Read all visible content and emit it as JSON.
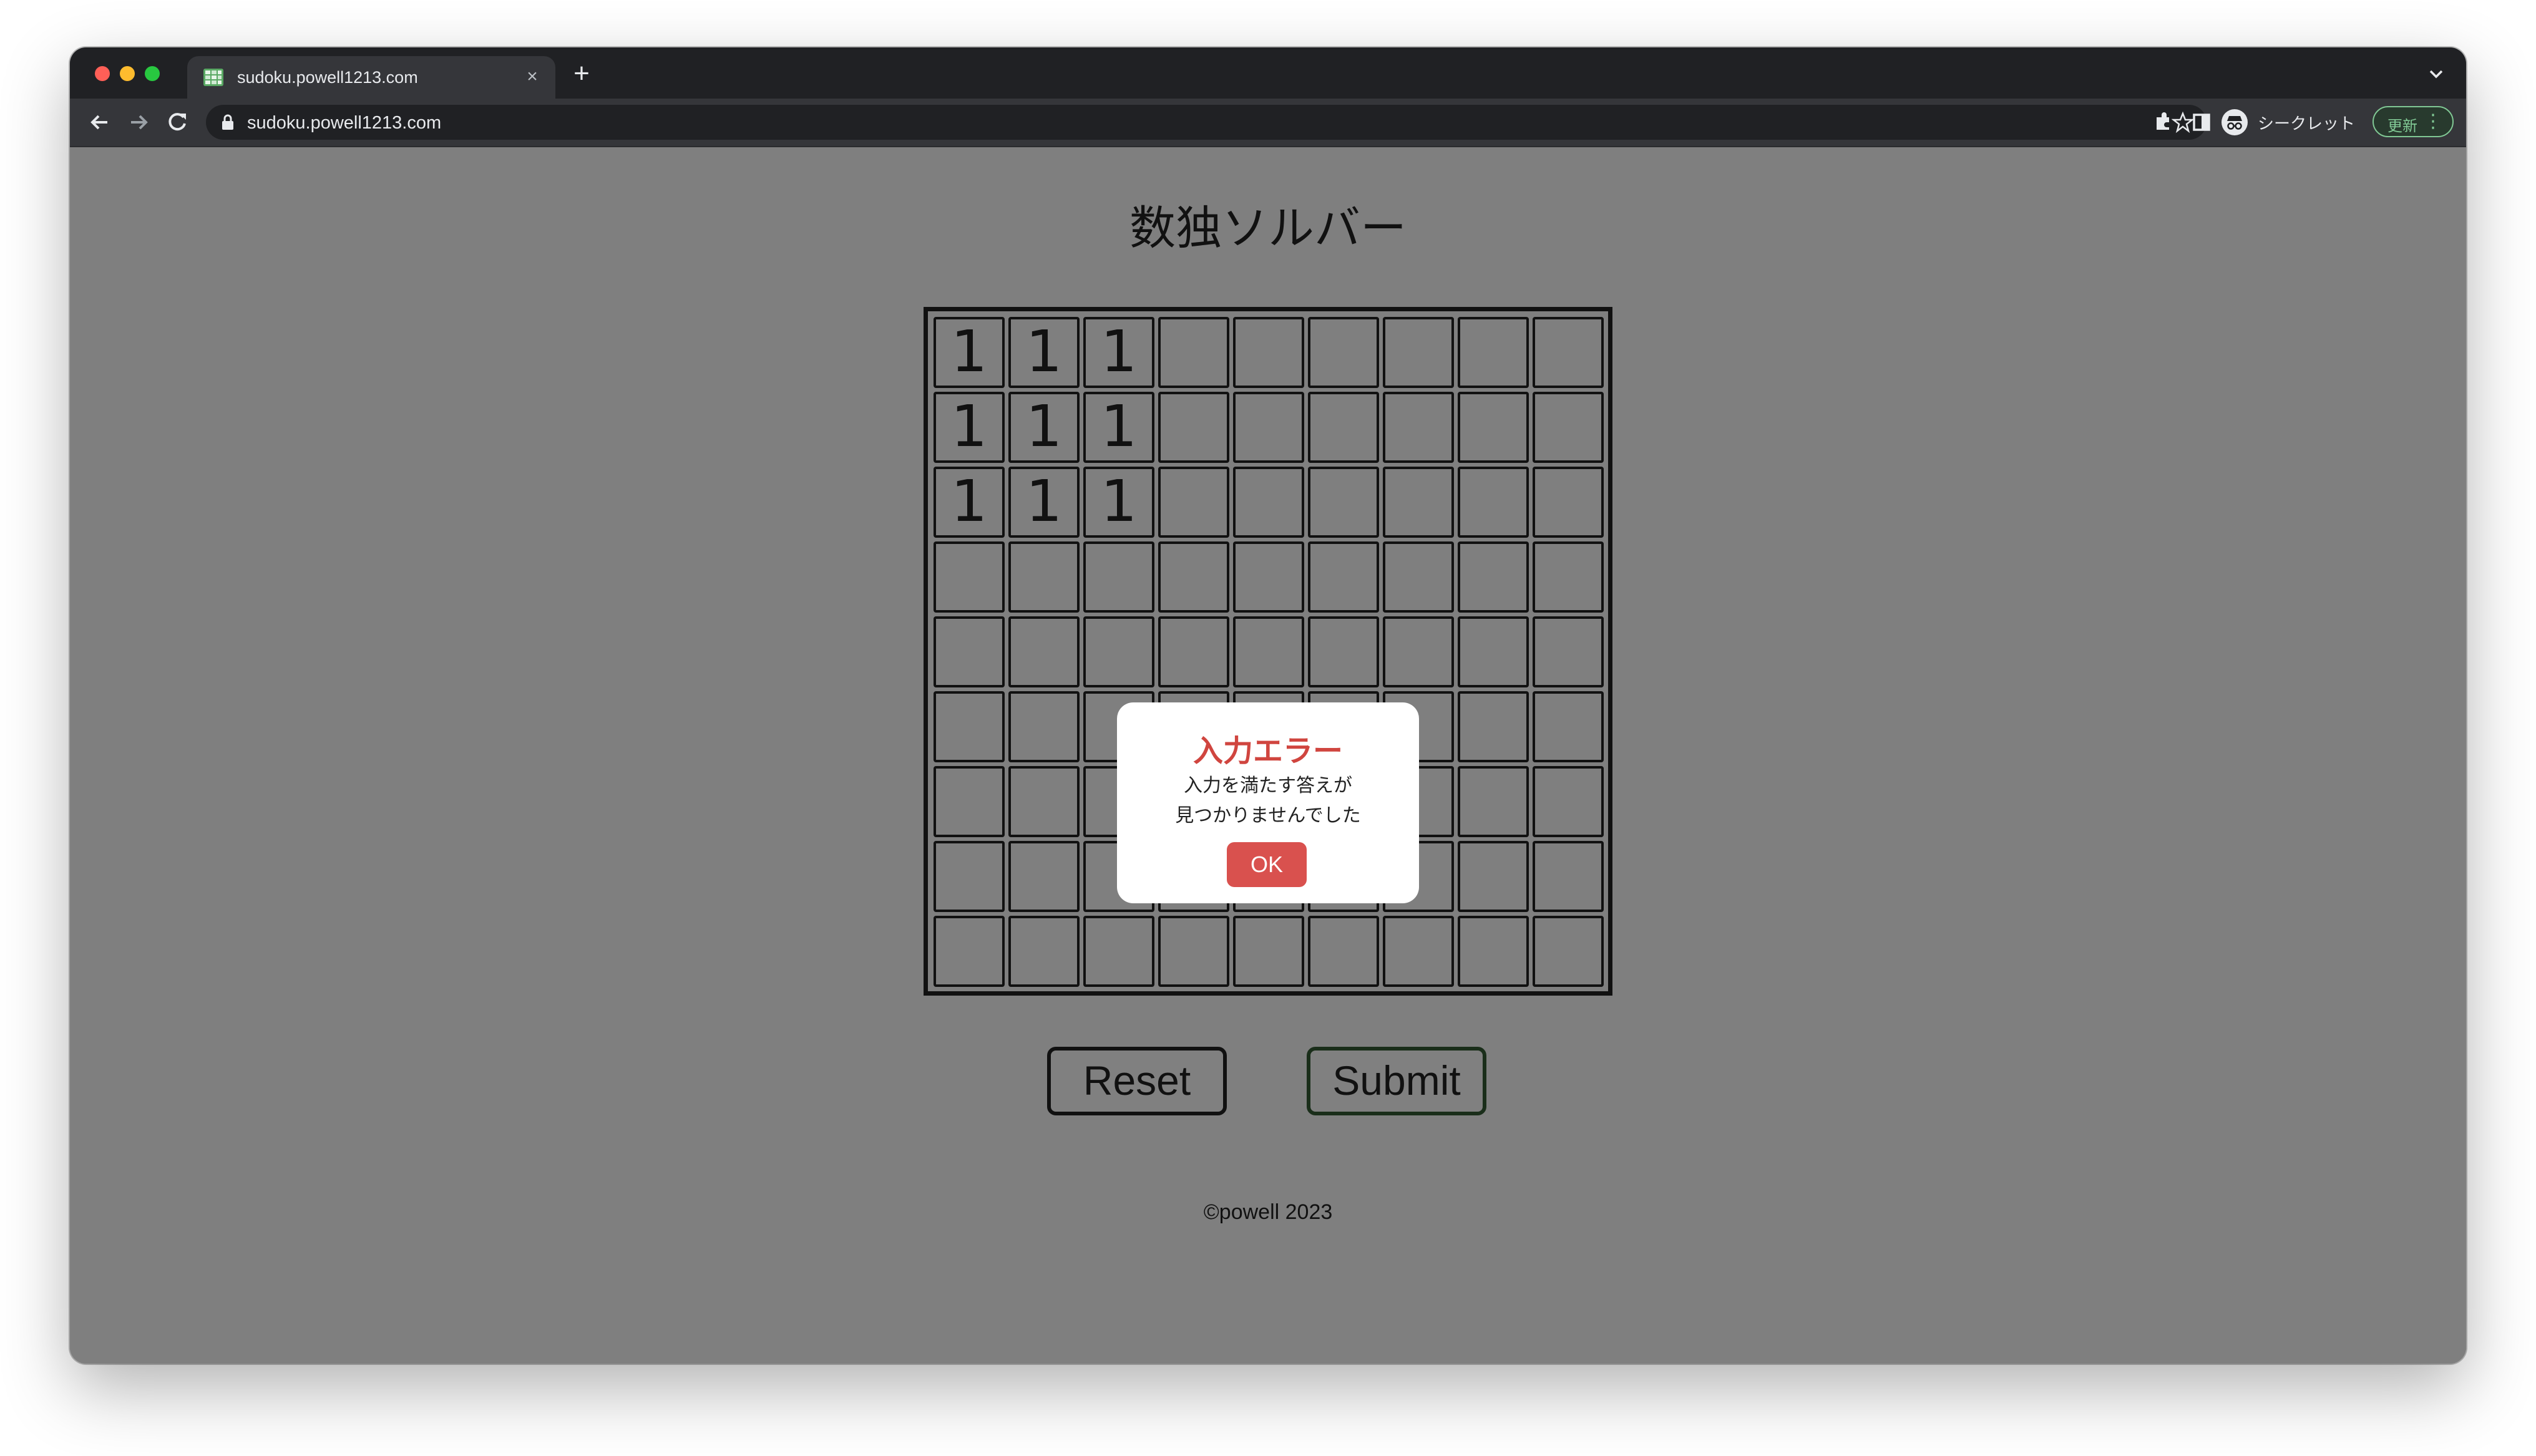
{
  "browser": {
    "tab_title": "sudoku.powell1213.com",
    "close_glyph": "×",
    "new_tab_glyph": "+",
    "url": "sudoku.powell1213.com",
    "incognito_label": "シークレット",
    "update_label": "更新",
    "menu_glyph": "⋮",
    "icons": [
      "back-icon",
      "forward-icon",
      "reload-icon",
      "lock-icon",
      "bookmark-star-icon",
      "extensions-icon",
      "side-panel-icon",
      "incognito-icon",
      "tab-search-chevron-icon"
    ]
  },
  "page": {
    "title": "数独ソルバー",
    "board": [
      [
        "1",
        "1",
        "1",
        "",
        "",
        "",
        "",
        "",
        ""
      ],
      [
        "1",
        "1",
        "1",
        "",
        "",
        "",
        "",
        "",
        ""
      ],
      [
        "1",
        "1",
        "1",
        "",
        "",
        "",
        "",
        "",
        ""
      ],
      [
        "",
        "",
        "",
        "",
        "",
        "",
        "",
        "",
        ""
      ],
      [
        "",
        "",
        "",
        "",
        "",
        "",
        "",
        "",
        ""
      ],
      [
        "",
        "",
        "",
        "",
        "",
        "",
        "",
        "",
        ""
      ],
      [
        "",
        "",
        "",
        "",
        "",
        "",
        "",
        "",
        ""
      ],
      [
        "",
        "",
        "",
        "",
        "",
        "",
        "",
        "",
        ""
      ],
      [
        "",
        "",
        "",
        "",
        "",
        "",
        "",
        "",
        ""
      ]
    ],
    "reset_label": "Reset",
    "submit_label": "Submit",
    "footer": "©powell 2023"
  },
  "dialog": {
    "title": "入力エラー",
    "line1": "入力を満たす答えが",
    "line2": "見つかりませんでした",
    "ok_label": "OK"
  },
  "colors": {
    "page_bg": "#7f7f7f",
    "dialog_title": "#d0453f",
    "ok_button": "#d9514e"
  }
}
